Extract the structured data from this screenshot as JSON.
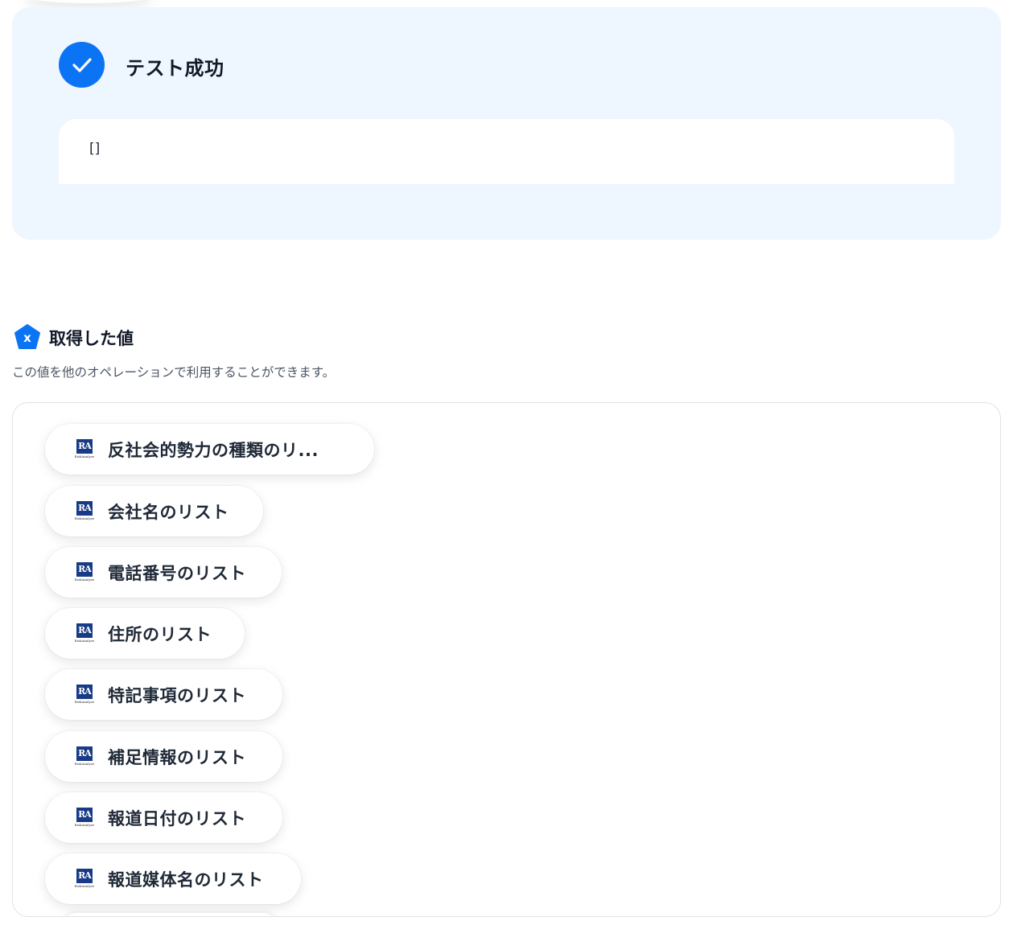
{
  "test_result": {
    "title": "テスト成功",
    "output": "[]"
  },
  "values_section": {
    "title": "取得した値",
    "description": "この値を他のオペレーションで利用することができます。"
  },
  "logo": {
    "mark": "RA",
    "caption": "RiskAnalyze"
  },
  "chips": [
    {
      "label": "反社会的勢力の種類のリ..."
    },
    {
      "label": "会社名のリスト"
    },
    {
      "label": "電話番号のリスト"
    },
    {
      "label": "住所のリスト"
    },
    {
      "label": "特記事項のリスト"
    },
    {
      "label": "補足情報のリスト"
    },
    {
      "label": "報道日付のリスト"
    },
    {
      "label": "報道媒体名のリスト"
    }
  ],
  "colors": {
    "accent": "#0b74f4",
    "panel_bg": "#eef6ff",
    "logo_bg": "#173b86"
  }
}
